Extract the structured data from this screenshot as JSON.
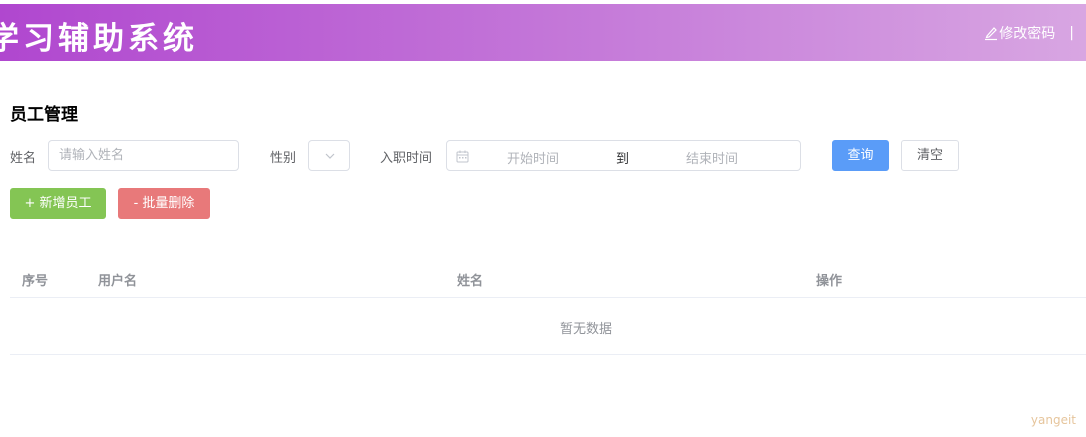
{
  "header": {
    "app_title": "学习辅助系统",
    "change_password_label": "修改密码",
    "separator": "|",
    "gradient_colors": [
      "#b047cf",
      "#c57ad9",
      "#d8a6e2"
    ]
  },
  "page": {
    "section_title": "员工管理"
  },
  "filters": {
    "name_label": "姓名",
    "name_placeholder": "请输入姓名",
    "name_value": "",
    "gender_label": "性别",
    "gender_value": "",
    "hire_date_label": "入职时间",
    "start_placeholder": "开始时间",
    "range_separator": "到",
    "end_placeholder": "结束时间"
  },
  "buttons": {
    "query": "查询",
    "clear": "清空",
    "add_employee": "+ 新增员工",
    "batch_delete": "- 批量删除",
    "colors": {
      "query": "#5a9cf8",
      "add": "#84c554",
      "delete": "#e8797a"
    }
  },
  "table": {
    "columns": [
      "序号",
      "用户名",
      "姓名",
      "操作"
    ],
    "rows": [],
    "empty_text": "暂无数据"
  },
  "watermark": "yangeit",
  "icons": {
    "change_password": "edit-icon",
    "gender_select": "chevron-down-icon",
    "date_range": "calendar-icon"
  }
}
